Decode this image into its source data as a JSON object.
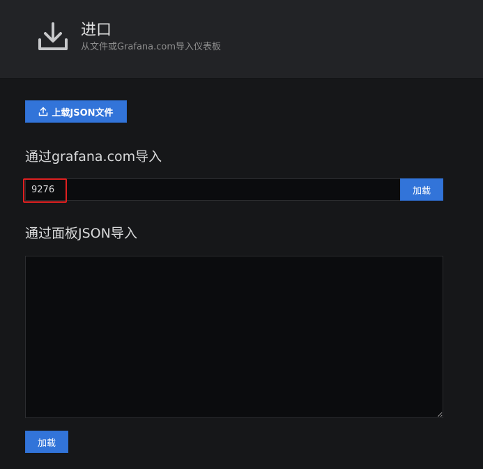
{
  "header": {
    "title": "进口",
    "subtitle": "从文件或Grafana.com导入仪表板",
    "icon": "download-icon"
  },
  "upload": {
    "label": "上载JSON文件",
    "icon": "upload-icon"
  },
  "grafana_import": {
    "title": "通过grafana.com导入",
    "input_value": "9276",
    "load_label": "加载"
  },
  "json_import": {
    "title": "通过面板JSON导入",
    "textarea_value": "",
    "load_label": "加载"
  },
  "colors": {
    "primary_button": "#3274d9",
    "highlight": "#e02020",
    "background": "#161719",
    "header_bg": "#222326"
  }
}
